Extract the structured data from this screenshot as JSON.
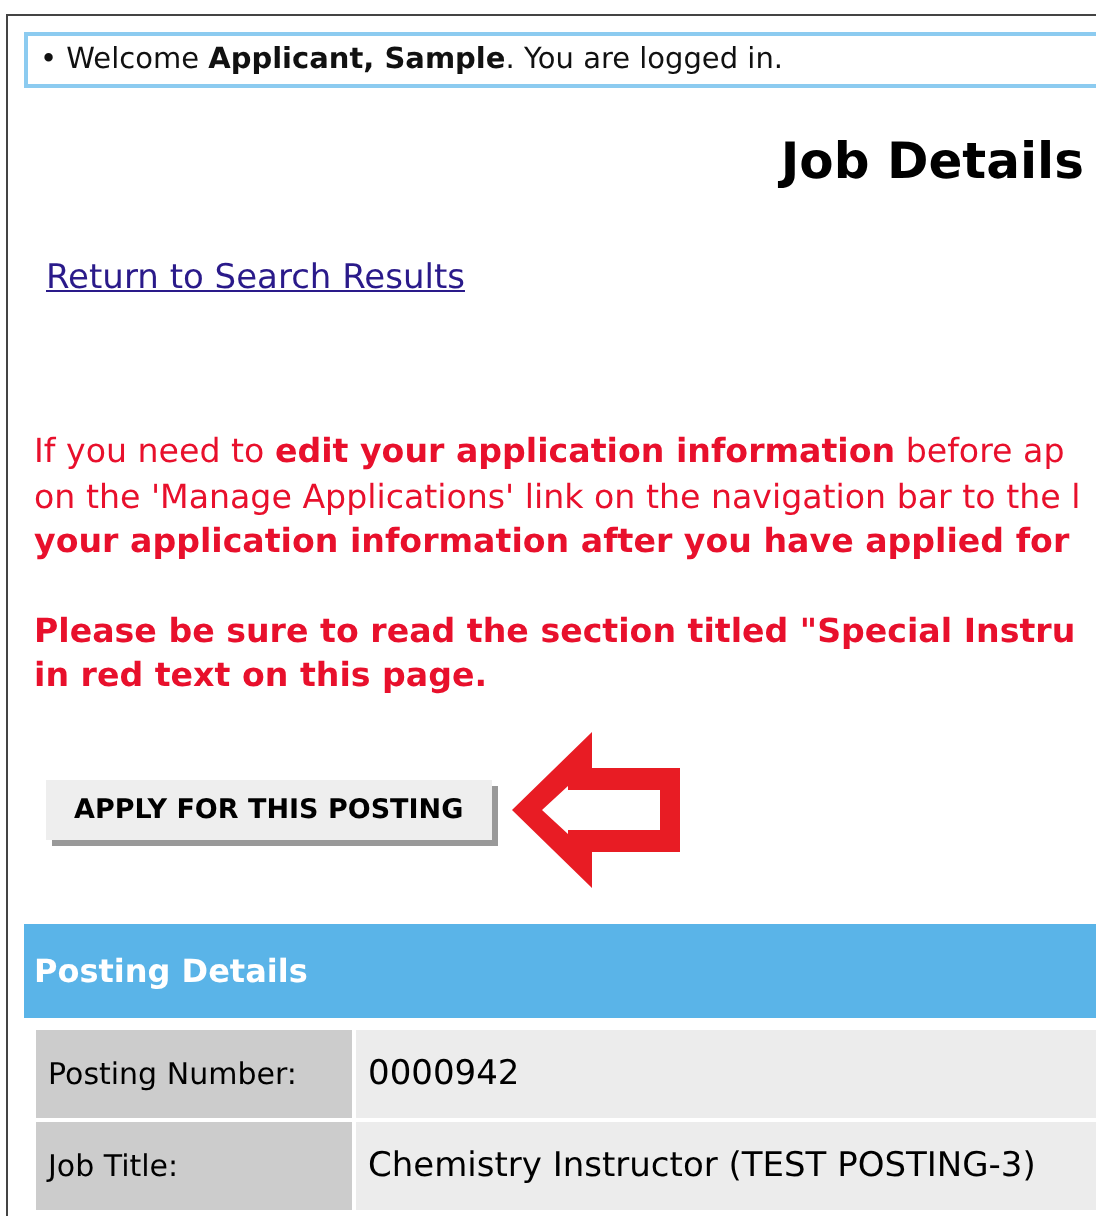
{
  "welcome": "• Welcome **Applicant, Sample**. You are logged in.",
  "page_title": "Job Details",
  "back_link": "Return to Search Results",
  "notice_lines": [
    "If you need to **edit your application information** before ap",
    "on the 'Manage Applications' link on the navigation bar to the l",
    "**your application information after you have applied for**"
  ],
  "warning_lines": [
    "Please be sure to read the section titled \"Special Instru",
    "in red text on this page."
  ],
  "apply_button": "APPLY FOR THIS POSTING",
  "section": {
    "title": "Posting Details",
    "rows": [
      {
        "label": "Posting Number:",
        "value": "0000942"
      },
      {
        "label": "Job Title:",
        "value": "Chemistry Instructor (TEST POSTING-3)"
      }
    ]
  }
}
